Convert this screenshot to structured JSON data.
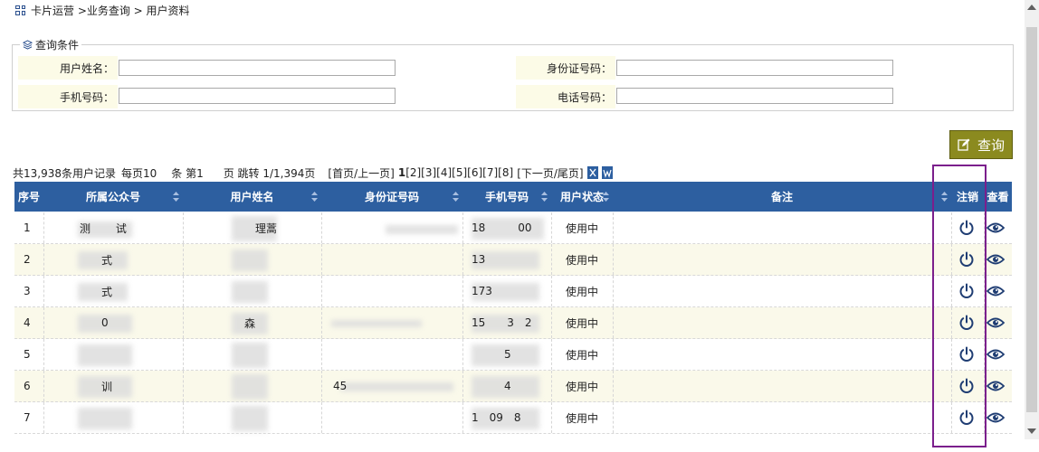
{
  "breadcrumb": {
    "text": "卡片运营 >业务查询 > 用户资料"
  },
  "query": {
    "legend": "查询条件",
    "fields": [
      {
        "label": "用户姓名：",
        "value": ""
      },
      {
        "label": "身份证号码：",
        "value": ""
      },
      {
        "label": "手机号码：",
        "value": ""
      },
      {
        "label": "电话号码：",
        "value": ""
      }
    ],
    "button_label": "查询"
  },
  "pager": {
    "total": "共13,938条用户记录",
    "per_page": "每页10",
    "item_label": "条 第1",
    "page_label": "页 跳转 1/1,394页",
    "first_prev": "[首页/上一页]",
    "current": "1",
    "pages": "[2][3][4][5][6][7][8]",
    "next_last": "[下一页/尾页]"
  },
  "table": {
    "columns": [
      "序号",
      "所属公众号",
      "用户姓名",
      "身份证号码",
      "手机号码",
      "用户状态",
      "备注",
      "注销",
      "查看"
    ],
    "rows": [
      {
        "index": "1",
        "account": "测   试",
        "name": "  理蒿",
        "id": "",
        "phone": "18   00",
        "status": "使用中"
      },
      {
        "index": "2",
        "account": "  式",
        "name": "",
        "id": "",
        "phone": "13",
        "status": "使用中"
      },
      {
        "index": "3",
        "account": "  式",
        "name": "",
        "id": "",
        "phone": "173",
        "status": "使用中"
      },
      {
        "index": "4",
        "account": "  0",
        "name": " 森",
        "id": "",
        "phone": "15  3 2",
        "status": "使用中"
      },
      {
        "index": "5",
        "account": "    ",
        "name": "",
        "id": "",
        "phone": "   5",
        "status": "使用中"
      },
      {
        "index": "6",
        "account": "  训",
        "name": "",
        "id": "45",
        "phone": "   4",
        "status": "使用中"
      },
      {
        "index": "7",
        "account": "   ",
        "name": "  ",
        "id": "",
        "phone": "1 09 8",
        "status": "使用中"
      }
    ]
  },
  "colors": {
    "header_bg": "#2d5fa0",
    "button_bg": "#8b8a1f",
    "highlight": "#7b1f8c",
    "label_bg": "#fcfbe7",
    "row_alt": "#faf9ea",
    "icon": "#1f3d73"
  },
  "icons": {
    "breadcrumb": "grid-icon",
    "legend": "layers-icon",
    "button": "edit-icon",
    "cancel": "power-icon",
    "view": "eye-icon",
    "export_excel": "excel-icon",
    "export_word": "word-icon"
  }
}
